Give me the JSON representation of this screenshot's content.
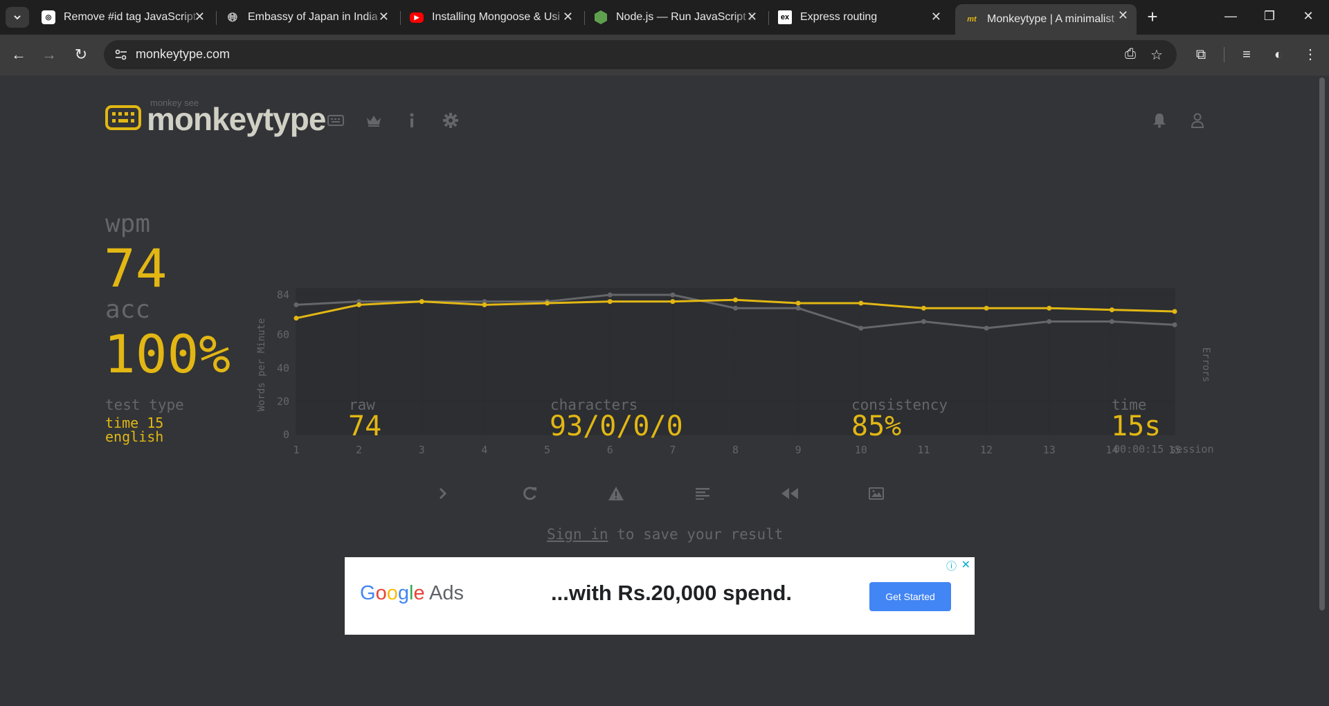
{
  "browser": {
    "tabs": [
      {
        "title": "Remove #id tag JavaScript",
        "favicon": "chatgpt-icon"
      },
      {
        "title": "Embassy of Japan in India",
        "favicon": "globe-icon"
      },
      {
        "title": "Installing Mongoose & Usi",
        "favicon": "youtube-icon"
      },
      {
        "title": "Node.js — Run JavaScript E",
        "favicon": "nodejs-icon"
      },
      {
        "title": "Express routing",
        "favicon": "express-icon"
      },
      {
        "title": "Monkeytype | A minimalist",
        "favicon": "monkeytype-icon"
      }
    ],
    "url": "monkeytype.com"
  },
  "header": {
    "logo_sub": "monkey see",
    "logo_text": "monkeytype"
  },
  "result": {
    "wpm_label": "wpm",
    "wpm_value": "74",
    "acc_label": "acc",
    "acc_value": "100%",
    "test_type_label": "test type",
    "test_type_line1": "time 15",
    "test_type_line2": "english",
    "raw_label": "raw",
    "raw_value": "74",
    "characters_label": "characters",
    "characters_value": "93/0/0/0",
    "consistency_label": "consistency",
    "consistency_value": "85%",
    "time_label": "time",
    "time_value": "15s",
    "session_note": "00:00:15 session"
  },
  "signin": {
    "link": "Sign in",
    "rest": " to save your result"
  },
  "ad": {
    "brand_letters": [
      "G",
      "o",
      "o",
      "g",
      "l",
      "e"
    ],
    "brand_ads": " Ads",
    "headline": "...with Rs.20,000 spend.",
    "cta": "Get Started",
    "info": "ⓘ",
    "close": "✕"
  },
  "colors": {
    "accent": "#e2b714",
    "raw_line": "#646669",
    "background": "#323437",
    "sub": "#646669"
  },
  "chart_data": {
    "type": "line",
    "x": [
      1,
      2,
      3,
      4,
      5,
      6,
      7,
      8,
      9,
      10,
      11,
      12,
      13,
      14,
      15
    ],
    "series": [
      {
        "name": "wpm",
        "values": [
          70,
          78,
          80,
          78,
          79,
          80,
          80,
          81,
          79,
          79,
          76,
          76,
          76,
          75,
          74
        ],
        "color": "#e2b714"
      },
      {
        "name": "raw",
        "values": [
          78,
          80,
          80,
          80,
          80,
          84,
          84,
          76,
          76,
          64,
          68,
          64,
          68,
          68,
          66
        ],
        "color": "#646669"
      }
    ],
    "ylabel": "Words per Minute",
    "y2label": "Errors",
    "yticks": [
      0,
      20,
      40,
      60,
      84
    ],
    "ylim": [
      0,
      84
    ],
    "grid": true
  }
}
